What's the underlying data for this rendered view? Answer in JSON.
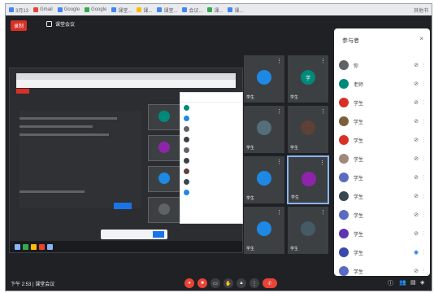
{
  "browser": {
    "tabs": [
      {
        "label": "3月13",
        "color": "#4285f4"
      },
      {
        "label": "Gmail",
        "color": "#ea4335"
      },
      {
        "label": "Google",
        "color": "#4285f4"
      },
      {
        "label": "Google",
        "color": "#34a853"
      },
      {
        "label": "课堂...",
        "color": "#4285f4"
      },
      {
        "label": "课...",
        "color": "#fbbc04"
      },
      {
        "label": "课堂...",
        "color": "#4285f4"
      },
      {
        "label": "会议...",
        "color": "#4285f4"
      },
      {
        "label": "课...",
        "color": "#34a853"
      },
      {
        "label": "课...",
        "color": "#4285f4"
      }
    ],
    "right_label": "其他书"
  },
  "meeting": {
    "record_label": "录制",
    "title": "课堂会议"
  },
  "panel": {
    "title": "参与者",
    "close": "×",
    "participants": [
      {
        "name": "你",
        "color": "#5f6368",
        "icon": "mic-off-icon"
      },
      {
        "name": "老师",
        "color": "#00897b",
        "icon": "mic-off-icon"
      },
      {
        "name": "学生",
        "color": "#d93025",
        "icon": "mic-off-icon"
      },
      {
        "name": "学生",
        "color": "#7b5e3b",
        "icon": "mic-off-icon"
      },
      {
        "name": "学生",
        "color": "#d93025",
        "icon": "mic-off-icon"
      },
      {
        "name": "学生",
        "color": "#a1887f",
        "icon": "mic-off-icon"
      },
      {
        "name": "学生",
        "color": "#5c6bc0",
        "icon": "mic-off-icon"
      },
      {
        "name": "学生",
        "color": "#37474f",
        "icon": "mic-off-icon"
      },
      {
        "name": "学生",
        "color": "#5c6bc0",
        "icon": "mic-off-icon"
      },
      {
        "name": "学生",
        "color": "#5e35b1",
        "icon": "mic-off-icon"
      },
      {
        "name": "学生",
        "color": "#3949ab",
        "icon": "mic-on-icon"
      },
      {
        "name": "学生",
        "color": "#5c6bc0",
        "icon": "mic-off-icon"
      }
    ]
  },
  "tiles": [
    {
      "name": "学生",
      "avatar_color": "#1e88e5",
      "initial": ""
    },
    {
      "name": "学生",
      "avatar_color": "#00897b",
      "initial": "学"
    },
    {
      "name": "学生",
      "avatar_color": "#546e7a",
      "initial": ""
    },
    {
      "name": "学生",
      "avatar_color": "#5d4037",
      "initial": ""
    },
    {
      "name": "学生",
      "avatar_color": "#1e88e5",
      "initial": ""
    },
    {
      "name": "学生",
      "avatar_color": "#8e24aa",
      "initial": ""
    },
    {
      "name": "学生",
      "avatar_color": "#1e88e5",
      "initial": ""
    },
    {
      "name": "学生",
      "avatar_color": "#455a64",
      "initial": ""
    }
  ],
  "bottom": {
    "time": "下午 2:53 | 课堂会议"
  }
}
